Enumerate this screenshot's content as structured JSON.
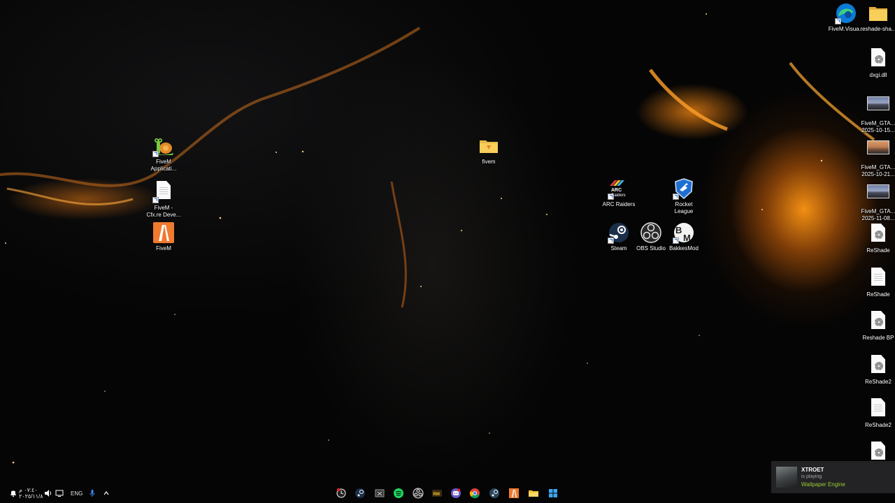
{
  "desktop": {
    "icons": {
      "fivem_application": {
        "label": "FiveM\nApplicati..."
      },
      "fivem_cfx": {
        "label": "FiveM -\nCfx.re Deve..."
      },
      "fivem": {
        "label": "FiveM"
      },
      "fivem_folder": {
        "label": "fivem"
      },
      "arc_raiders": {
        "label": "ARC Raiders"
      },
      "rocket_league": {
        "label": "Rocket\nLeague"
      },
      "steam": {
        "label": "Steam"
      },
      "obs_studio": {
        "label": "OBS Studio"
      },
      "bakkesmod": {
        "label": "BakkesMod"
      },
      "fivem_visual": {
        "label": "FiveM.Visua..."
      },
      "reshade_sha": {
        "label": "reshade-sha..."
      },
      "dxgi_dll": {
        "label": "dxgi.dll"
      },
      "fivem_gta_1": {
        "label": "FiveM_GTA...\n2025-10-15..."
      },
      "fivem_gta_2": {
        "label": "FiveM_GTA...\n2025-10-21..."
      },
      "fivem_gta_3": {
        "label": "FiveM_GTA...\n2025-11-08..."
      },
      "reshade_1": {
        "label": "ReShade"
      },
      "reshade_2": {
        "label": "ReShade"
      },
      "reshade_bp": {
        "label": "Reshade BP"
      },
      "reshade2_1": {
        "label": "ReShade2"
      },
      "reshade2_2": {
        "label": "ReShade2"
      }
    }
  },
  "taskbar": {
    "clock": {
      "time": "٠٧:٤٠ م",
      "date": "٢٠٢٥/١١/٨"
    },
    "language": "ENG",
    "pinned": [
      "clock-app",
      "steam",
      "xbox",
      "spotify",
      "obs-studio",
      "game-app",
      "discord",
      "chrome",
      "steam-2",
      "fivem",
      "file-explorer",
      "windows-start"
    ]
  },
  "notification": {
    "name": "XTROET",
    "status": "is playing",
    "game": "Wallpaper Engine"
  },
  "colors": {
    "accent_green": "#9acd32",
    "nebula_orange": "#ff9a1e"
  }
}
